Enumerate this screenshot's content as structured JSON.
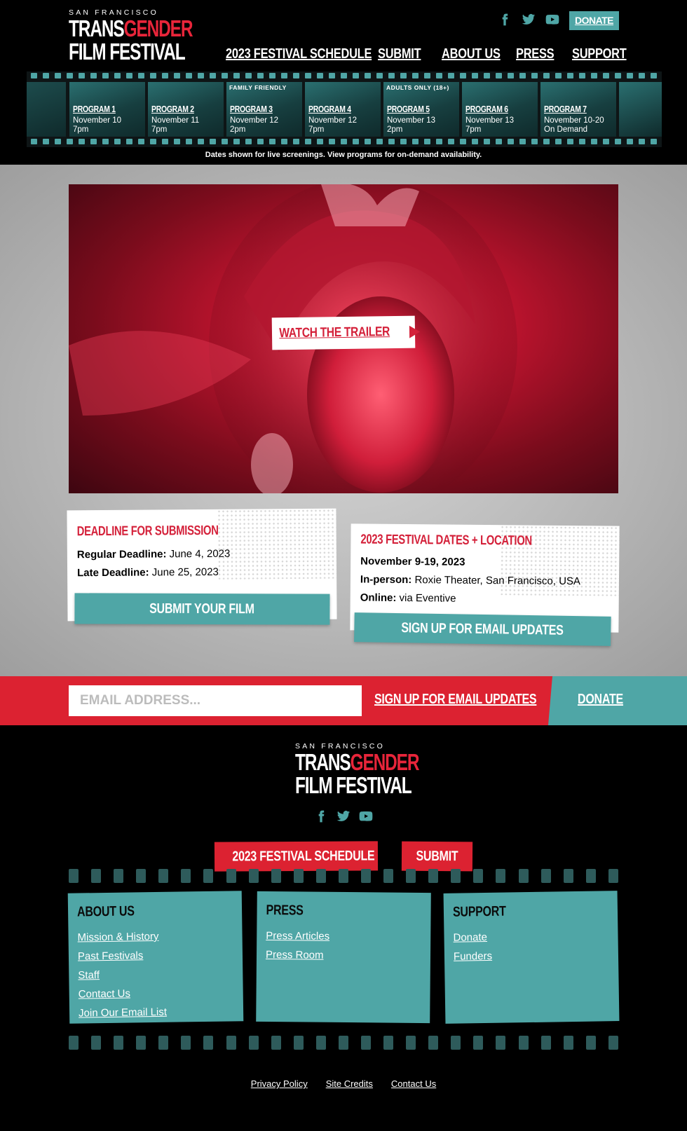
{
  "header": {
    "logo": {
      "sf": "SAN FRANCISCO",
      "trans": "TRANS",
      "gender": "GENDER",
      "line2": "FILM FESTIVAL"
    },
    "donate_label": "DONATE",
    "nav": [
      "2023 FESTIVAL SCHEDULE",
      "SUBMIT",
      "ABOUT US",
      "PRESS",
      "SUPPORT"
    ]
  },
  "filmstrip": {
    "programs": [
      {
        "tag": "",
        "title": "PROGRAM 1",
        "date": "November 10",
        "time": "7pm"
      },
      {
        "tag": "",
        "title": "PROGRAM 2",
        "date": "November 11",
        "time": "7pm"
      },
      {
        "tag": "FAMILY FRIENDLY",
        "title": "PROGRAM 3",
        "date": "November 12",
        "time": "2pm"
      },
      {
        "tag": "",
        "title": "PROGRAM 4",
        "date": "November 12",
        "time": "7pm"
      },
      {
        "tag": "ADULTS ONLY (18+)",
        "title": "PROGRAM 5",
        "date": "November 13",
        "time": "2pm"
      },
      {
        "tag": "",
        "title": "PROGRAM 6",
        "date": "November 13",
        "time": "7pm"
      },
      {
        "tag": "",
        "title": "PROGRAM 7",
        "date": "November 10-20",
        "time": "On Demand"
      }
    ],
    "note": "Dates shown for live screenings. View programs for on-demand availability."
  },
  "hero": {
    "trailer_label": "WATCH THE TRAILER"
  },
  "cards": {
    "submission": {
      "title": "DEADLINE FOR SUBMISSION",
      "regular_label": "Regular Deadline:",
      "regular_value": "June 4, 2023",
      "late_label": "Late Deadline:",
      "late_value": "June 25, 2023",
      "button": "SUBMIT YOUR FILM"
    },
    "dates": {
      "title": "2023 FESTIVAL DATES + LOCATION",
      "dates_line": "November 9-19, 2023",
      "inperson_label": "In-person:",
      "inperson_value": "Roxie Theater, San Francisco, USA",
      "online_label": "Online:",
      "online_value": "via Eventive",
      "button": "SIGN UP FOR EMAIL UPDATES"
    }
  },
  "emailbar": {
    "placeholder": "EMAIL ADDRESS...",
    "signup_label": "SIGN UP FOR EMAIL UPDATES",
    "donate_label": "DONATE"
  },
  "footer": {
    "schedule_btn": "2023 FESTIVAL SCHEDULE",
    "submit_btn": "SUBMIT",
    "panels": [
      {
        "title": "ABOUT US",
        "links": [
          "Mission & History",
          "Past Festivals",
          "Staff",
          "Contact Us",
          "Join Our Email List"
        ]
      },
      {
        "title": "PRESS",
        "links": [
          "Press Articles",
          "Press Room"
        ]
      },
      {
        "title": "SUPPORT",
        "links": [
          "Donate",
          "Funders"
        ]
      }
    ],
    "legal": [
      "Privacy Policy",
      "Site Credits",
      "Contact Us"
    ]
  },
  "colors": {
    "teal": "#4fa6a6",
    "red": "#dc2231",
    "black": "#000000"
  }
}
